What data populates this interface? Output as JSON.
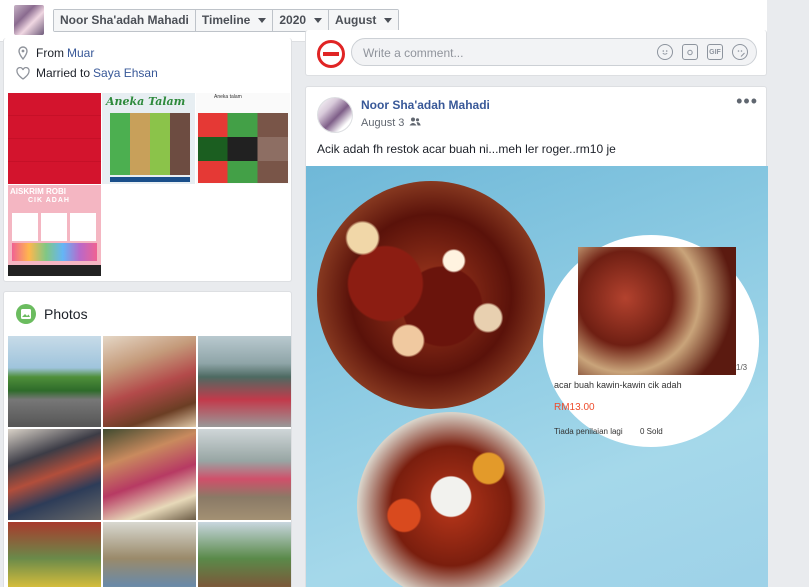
{
  "header": {
    "name": "Noor Sha'adah Mahadi",
    "tabs": [
      {
        "label": "Timeline"
      },
      {
        "label": "2020"
      },
      {
        "label": "August"
      }
    ]
  },
  "intro": {
    "from_label": "From",
    "from_value": "Muar",
    "married_label": "Married to",
    "married_value": "Saya Ehsan",
    "featured_texts": {
      "aneka": "Aneka Talam",
      "aneka_sub": "Aneka talam",
      "aiskrim": "AISKRIM ROBI",
      "cik_adah": "CIK ADAH"
    }
  },
  "photos": {
    "title": "Photos"
  },
  "comment": {
    "placeholder": "Write a comment...",
    "icons": [
      "emoji-icon",
      "camera-icon",
      "gif-icon",
      "sticker-icon"
    ],
    "gif": "GIF"
  },
  "post": {
    "author": "Noor Sha'adah Mahadi",
    "date": "August 3",
    "more": "•••",
    "text": "Acik adah fh restok acar buah ni...meh ler roger..rm10 je",
    "shop": {
      "pager": "1/3",
      "product": "acar buah kawin-kawin cik adah",
      "price": "RM13.00",
      "rating": "Tiada penilaian lagi",
      "sold": "0 Sold"
    }
  }
}
